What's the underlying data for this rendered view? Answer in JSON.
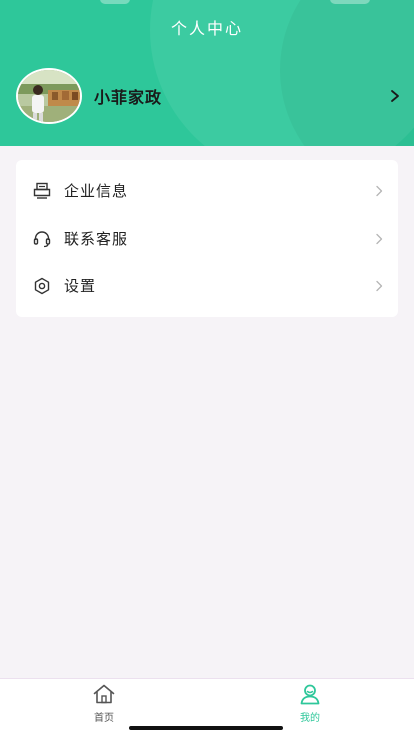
{
  "header": {
    "title": "个人中心",
    "background_color": "#2ec79a"
  },
  "profile": {
    "name": "小菲家政",
    "avatar_icon": "avatar-photo",
    "chevron_icon": "chevron-right-icon"
  },
  "menu": {
    "items": [
      {
        "label": "企业信息",
        "icon": "printer-icon"
      },
      {
        "label": "联系客服",
        "icon": "headset-icon"
      },
      {
        "label": "设置",
        "icon": "gear-icon"
      }
    ]
  },
  "tabbar": {
    "tabs": [
      {
        "label": "首页",
        "icon": "home-icon",
        "active": false
      },
      {
        "label": "我的",
        "icon": "user-icon",
        "active": true
      }
    ],
    "active_color": "#2ec79a"
  }
}
